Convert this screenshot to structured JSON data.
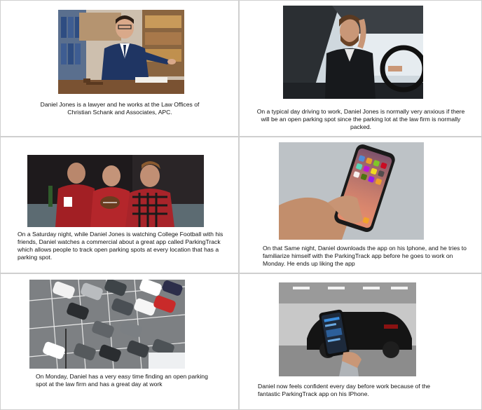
{
  "panels": [
    {
      "image": "lawyer-at-desk-photo",
      "caption": "Daniel Jones is a lawyer and he works at the Law Offices of Christian Schank and Associates, APC."
    },
    {
      "image": "man-driving-car-photo",
      "caption": "On a typical day driving to work, Daniel Jones is normally very anxious if there will be an open parking spot since the parking lot at the law firm is normally packed."
    },
    {
      "image": "friends-watching-football-photo",
      "caption": "On a Saturday night, while Daniel Jones is watching College Football with his friends, Daniel watches a commercial about a great app called ParkingTrack which allows people to track open parking spots at every location that has a parking spot."
    },
    {
      "image": "hand-holding-iphone-photo",
      "caption": "On that Same night, Daniel downloads the app on his Iphone, and he tries to familiarize himself with the ParkingTrack app before he goes to work on Monday.  He ends up liking the app"
    },
    {
      "image": "parking-lot-aerial-photo",
      "caption": "On Monday, Daniel has a very easy time finding an open parking spot at the law firm and has a great day at work"
    },
    {
      "image": "phone-in-garage-photo",
      "caption": "Daniel now feels confident every day before work because of the fantastic ParkingTrack app on his IPhone."
    }
  ]
}
